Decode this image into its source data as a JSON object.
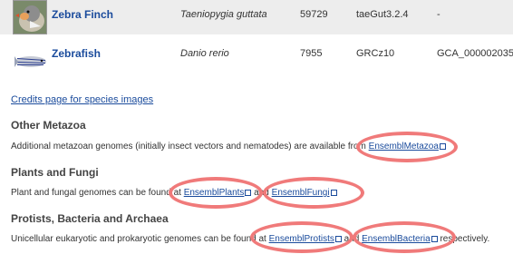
{
  "species": [
    {
      "common_name": "Zebra Finch",
      "scientific_name": "Taeniopygia guttata",
      "taxon_id": "59729",
      "assembly": "taeGut3.2.4",
      "accession": "-"
    },
    {
      "common_name": "Zebrafish",
      "scientific_name": "Danio rerio",
      "taxon_id": "7955",
      "assembly": "GRCz10",
      "accession": "GCA_000002035"
    }
  ],
  "credits_link": "Credits page for species images",
  "sections": {
    "metazoa": {
      "heading": "Other Metazoa",
      "text_before": "Additional metazoan genomes (initially insect vectors and nematodes) are available from ",
      "link": "EnsemblMetazoa",
      "text_after": ""
    },
    "plants_fungi": {
      "heading": "Plants and Fungi",
      "text_before": "Plant and fungal genomes can be found at ",
      "link1": "EnsemblPlants",
      "text_mid": " and ",
      "link2": "EnsemblFungi",
      "text_after": ""
    },
    "protists": {
      "heading": "Protists, Bacteria and Archaea",
      "text_before": "Unicellular eukaryotic and prokaryotic genomes can be found at ",
      "link1": "EnsemblProtists",
      "text_mid": " and ",
      "link2": "EnsemblBacteria",
      "text_after": " respectively."
    }
  },
  "colors": {
    "link": "#1a4b9c",
    "highlight": "#f07a7a",
    "row_shade": "#ededed"
  }
}
